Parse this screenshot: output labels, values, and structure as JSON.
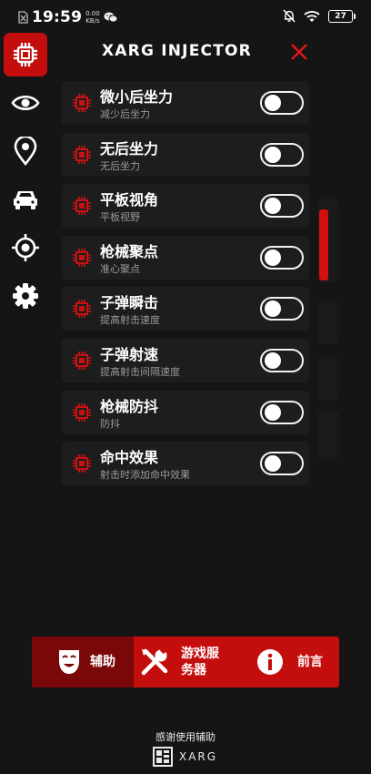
{
  "status_bar": {
    "time": "19:59",
    "speed_value": "0.00",
    "speed_unit": "KB/s",
    "battery": "27"
  },
  "header": {
    "title": "XARG INJECTOR"
  },
  "sidebar": {
    "items": [
      {
        "icon": "chip-icon",
        "active": true
      },
      {
        "icon": "eye-icon",
        "active": false
      },
      {
        "icon": "location-pin-icon",
        "active": false
      },
      {
        "icon": "car-icon",
        "active": false
      },
      {
        "icon": "crosshair-icon",
        "active": false
      },
      {
        "icon": "gear-icon",
        "active": false
      }
    ]
  },
  "features": [
    {
      "label": "微小后坐力",
      "sub": "减少后坐力",
      "enabled": false
    },
    {
      "label": "无后坐力",
      "sub": "无后坐力",
      "enabled": false
    },
    {
      "label": "平板视角",
      "sub": "平板视野",
      "enabled": false
    },
    {
      "label": "枪械聚点",
      "sub": "准心聚点",
      "enabled": false
    },
    {
      "label": "子弹瞬击",
      "sub": "提高射击速度",
      "enabled": false
    },
    {
      "label": "子弹射速",
      "sub": "提高射击间隔速度",
      "enabled": false
    },
    {
      "label": "枪械防抖",
      "sub": "防抖",
      "enabled": false
    },
    {
      "label": "命中效果",
      "sub": "射击时添加命中效果",
      "enabled": false
    }
  ],
  "tabs": {
    "assist": {
      "label": "辅助",
      "icon": "mask-icon"
    },
    "server_line1": "游戏服",
    "server_line2": "务器",
    "server_icon": "tools-icon",
    "preface": {
      "label": "前言",
      "icon": "info-icon"
    }
  },
  "footer": {
    "thanks": "感谢使用辅助",
    "logo_text": "XARG"
  },
  "colors": {
    "accent": "#c40d0d",
    "accent_dark": "#7a0808",
    "background": "#151515",
    "row": "#1d1d1d"
  }
}
